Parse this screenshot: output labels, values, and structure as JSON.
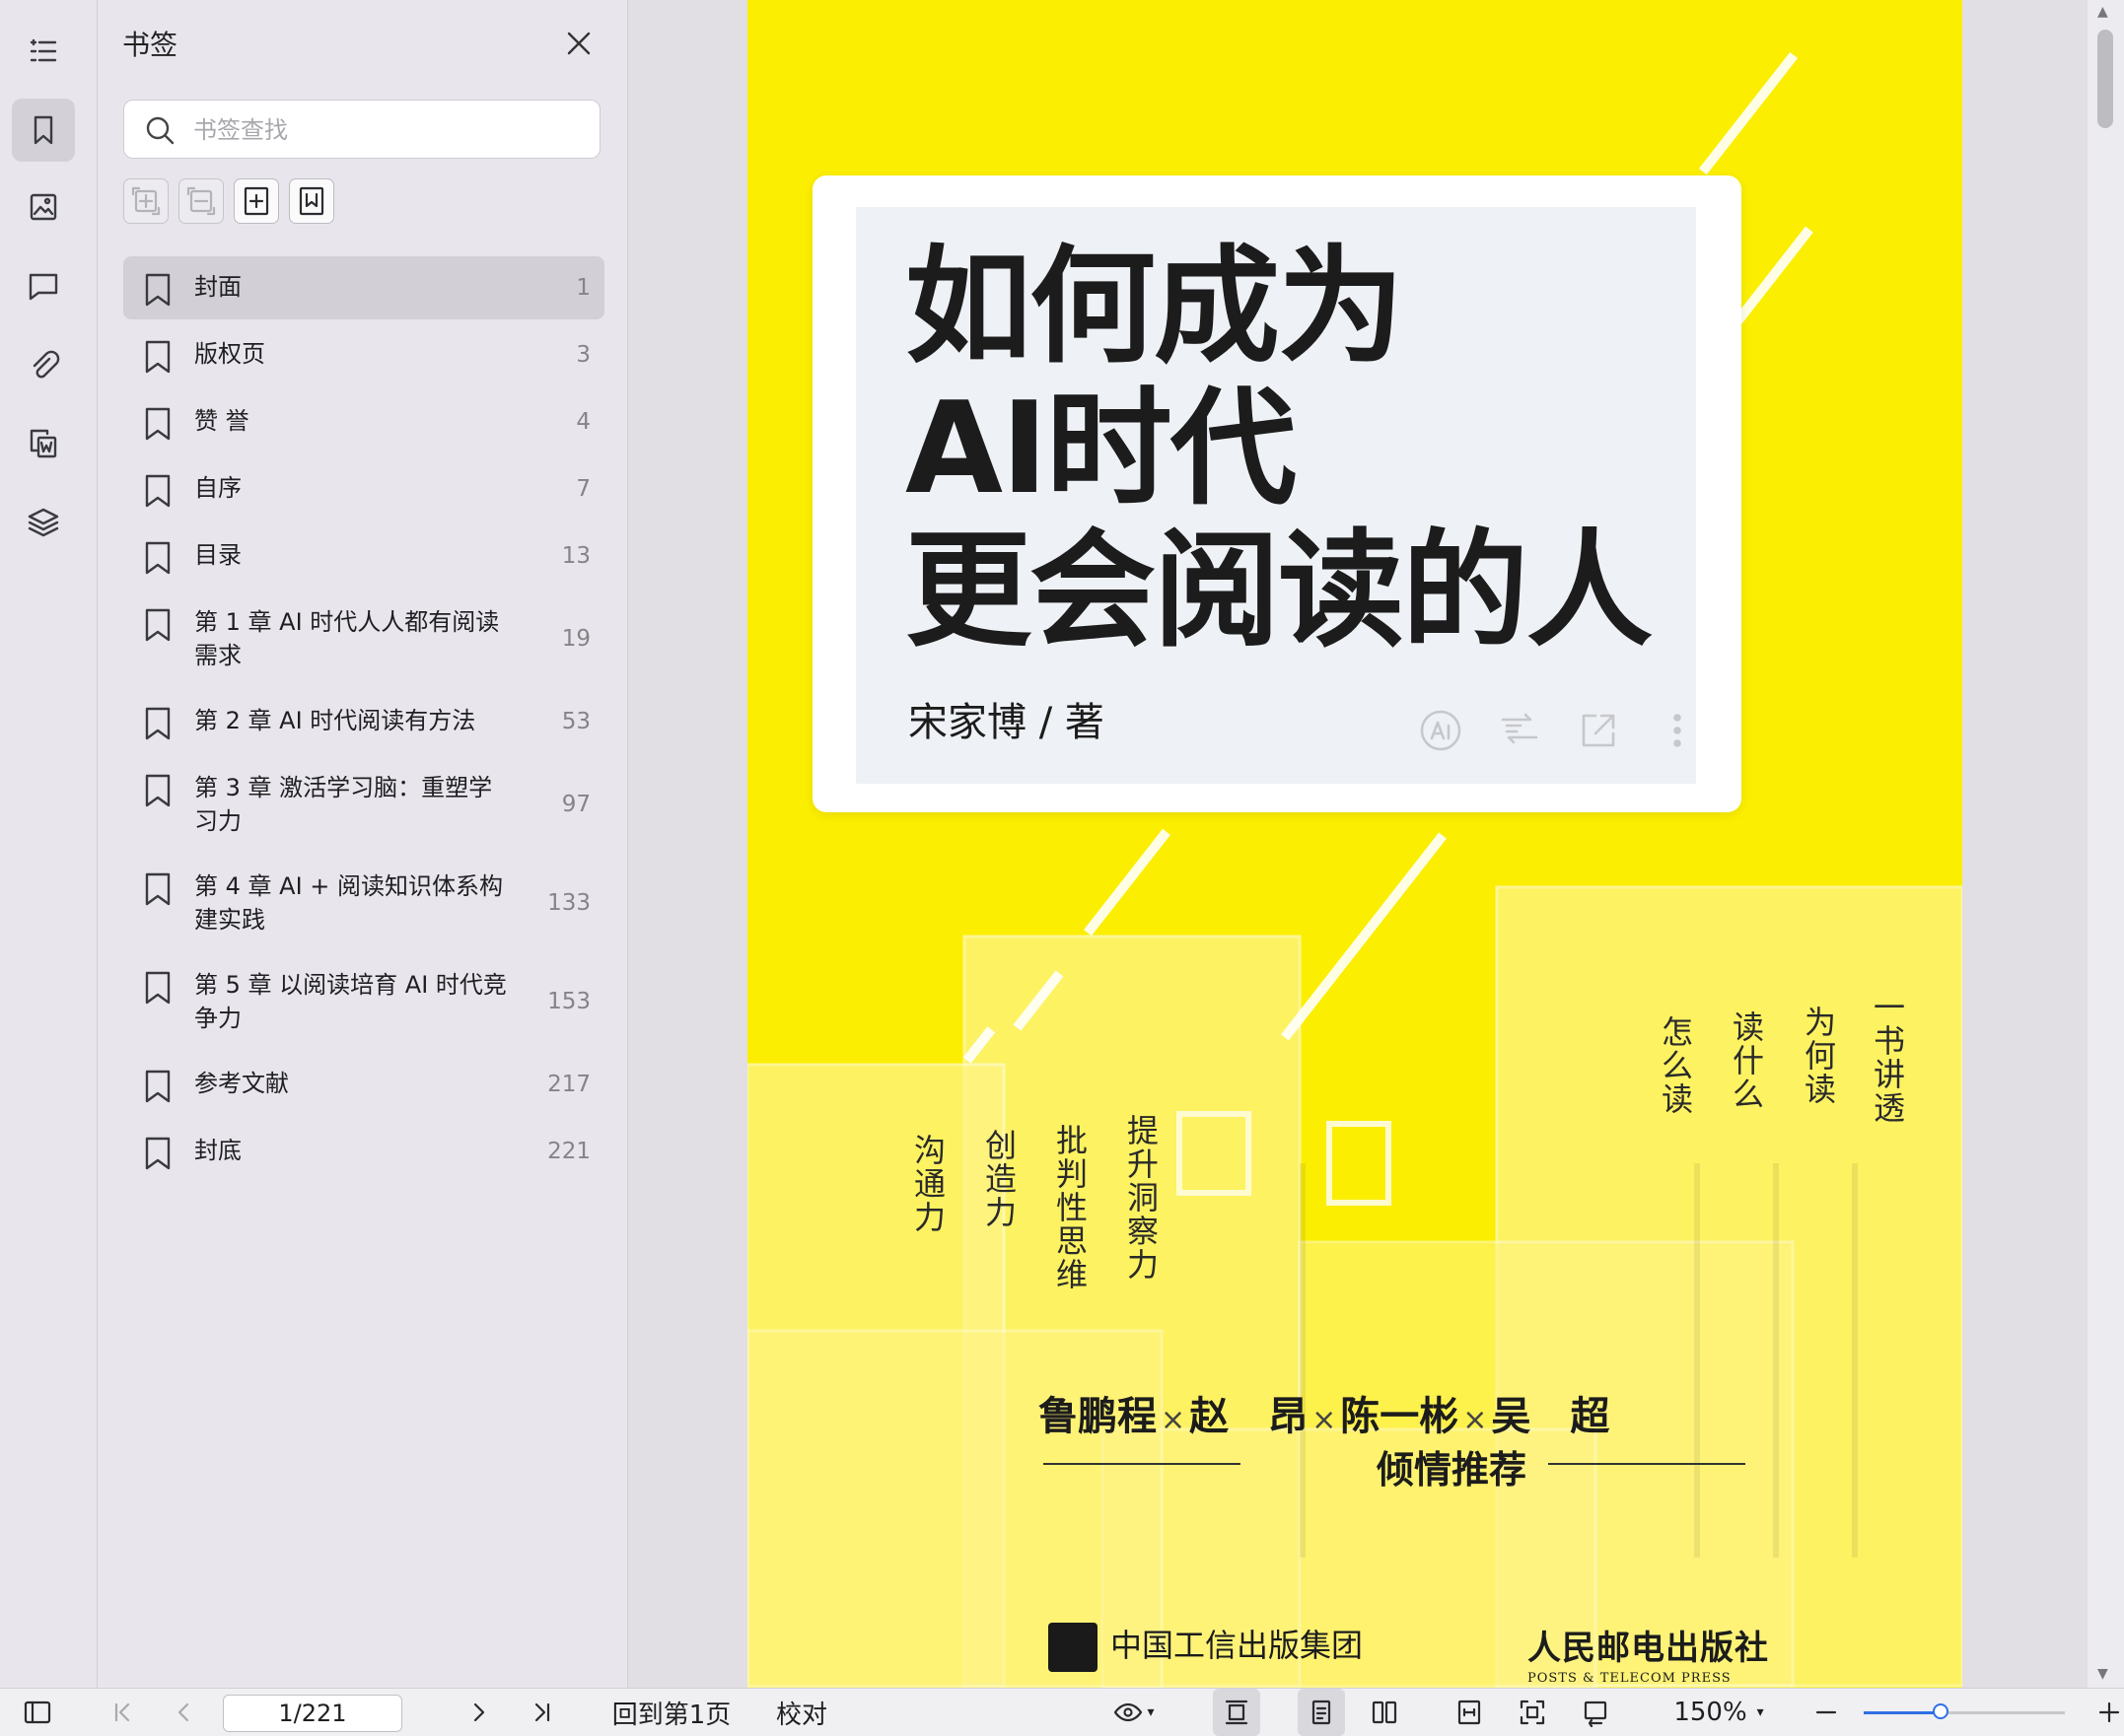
{
  "rail": {
    "items": [
      {
        "name": "outline-icon",
        "active": false
      },
      {
        "name": "bookmark-icon",
        "active": true
      },
      {
        "name": "thumbnail-icon",
        "active": false
      },
      {
        "name": "comment-icon",
        "active": false
      },
      {
        "name": "attachment-icon",
        "active": false
      },
      {
        "name": "word-convert-icon",
        "active": false
      },
      {
        "name": "layers-icon",
        "active": false
      }
    ]
  },
  "panel": {
    "title": "书签",
    "search_placeholder": "书签查找",
    "bookmarks": [
      {
        "label": "封面",
        "page": "1",
        "selected": true
      },
      {
        "label": "版权页",
        "page": "3"
      },
      {
        "label": "赞 誉",
        "page": "4"
      },
      {
        "label": "自序",
        "page": "7"
      },
      {
        "label": "目录",
        "page": "13"
      },
      {
        "label": "第 1 章 AI 时代人人都有阅读需求",
        "page": "19"
      },
      {
        "label": "第 2 章 AI 时代阅读有方法",
        "page": "53"
      },
      {
        "label": "第 3 章 激活学习脑：重塑学习力",
        "page": "97"
      },
      {
        "label": "第 4 章 AI + 阅读知识体系构建实践",
        "page": "133"
      },
      {
        "label": "第 5 章 以阅读培育 AI 时代竞争力",
        "page": "153"
      },
      {
        "label": "参考文献",
        "page": "217"
      },
      {
        "label": "封底",
        "page": "221"
      }
    ]
  },
  "cover": {
    "title_lines": [
      "如何成为",
      "AI时代",
      "更会阅读的人"
    ],
    "author": "宋家博 / 著",
    "right_phrases": [
      "一书讲透",
      "为何读",
      "读什么",
      "怎么读"
    ],
    "left_phrases": [
      "提升洞察力",
      "批判性思维",
      "创造力",
      "沟通力"
    ],
    "recommenders": [
      "鲁鹏程",
      "赵　昂",
      "陈一彬",
      "吴　超"
    ],
    "recommend_label": "倾情推荐",
    "publisher_1": "中国工信出版集团",
    "publisher_2_cn": "人民邮电出版社",
    "publisher_2_en": "POSTS & TELECOM PRESS",
    "background_color": "#fbee00"
  },
  "toolbar": {
    "page_value": "1/221",
    "goto_first_label": "回到第1页",
    "proofread_label": "校对",
    "zoom_label": "150%",
    "zoom_slider_fraction": 0.38
  }
}
